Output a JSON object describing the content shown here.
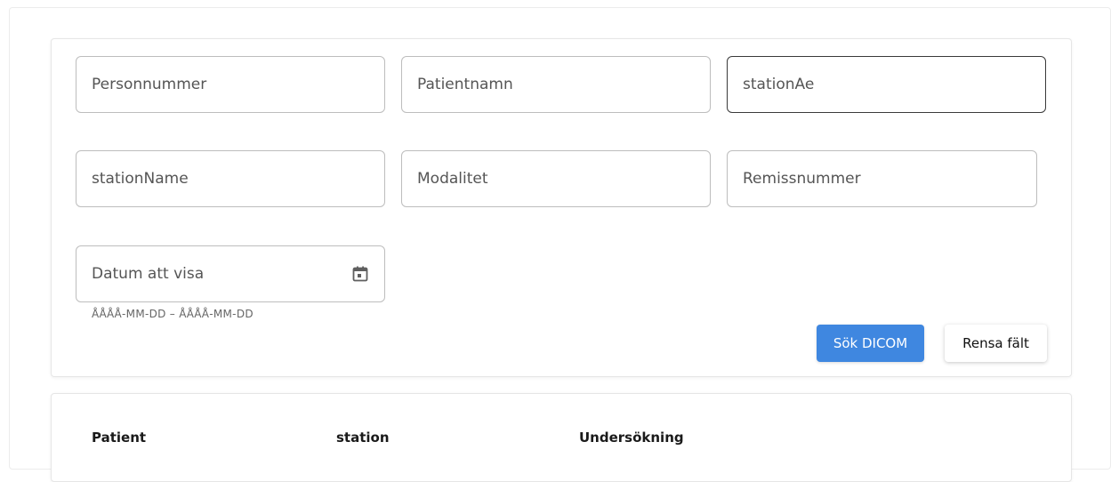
{
  "search_form": {
    "fields": {
      "personnummer": "Personnummer",
      "patientnamn": "Patientnamn",
      "station_ae": "stationAe",
      "station_name": "stationName",
      "modalitet": "Modalitet",
      "remissnummer": "Remissnummer",
      "datum": "Datum att visa"
    },
    "date_hint": "ÅÅÅÅ-MM-DD – ÅÅÅÅ-MM-DD",
    "search_button": "Sök DICOM",
    "clear_button": "Rensa fält"
  },
  "results_table": {
    "columns": [
      "Patient",
      "station",
      "Undersökning"
    ]
  },
  "colors": {
    "primary": "#3f87e0",
    "focused_border": "#3a3a3a",
    "field_border": "#bdbdbd"
  },
  "icons": {
    "date_picker": "calendar-icon"
  }
}
